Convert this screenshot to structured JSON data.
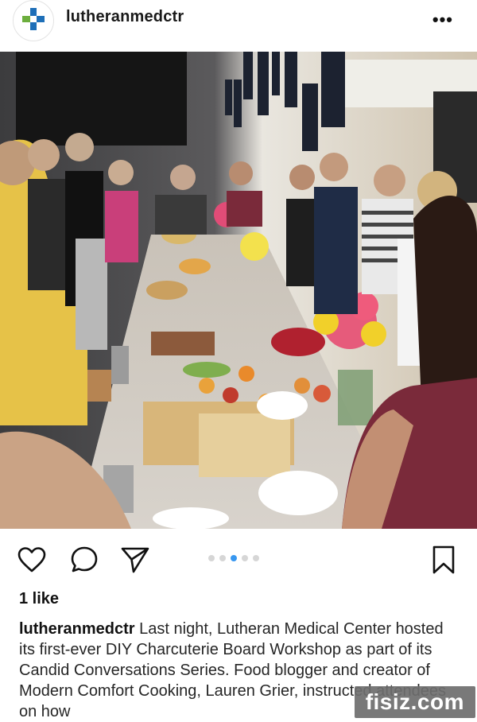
{
  "header": {
    "username": "lutheranmedctr",
    "more_label": "•••",
    "avatar_icon": "medical-cross-logo-icon"
  },
  "post": {
    "photo_alt": "",
    "user_tag_icon": "user-tag-icon",
    "carousel_count": 5,
    "carousel_active_index": 2
  },
  "actions": {
    "like_icon": "heart-icon",
    "comment_icon": "comment-icon",
    "share_icon": "send-icon",
    "save_icon": "bookmark-icon"
  },
  "likes": "1 like",
  "caption": {
    "username": "lutheranmedctr",
    "text": " Last night, Lutheran Medical Center hosted its first-ever DIY Charcuterie Board Workshop as part of its Candid Conversations Series. Food blogger and creator of Modern Comfort Cooking, Lauren Grier, instructed attendees on how"
  },
  "watermark": "fisiz.com",
  "colors": {
    "accent_blue": "#3897f0",
    "logo_blue": "#1e6fb8",
    "logo_green": "#6cae3e"
  }
}
